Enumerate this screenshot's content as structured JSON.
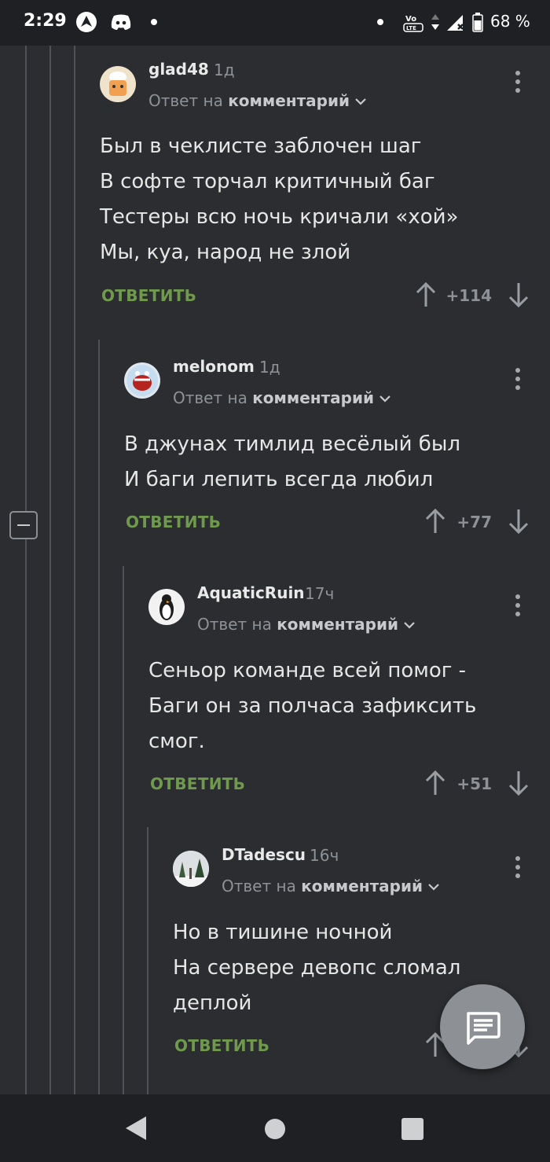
{
  "status_bar": {
    "time": "2:29",
    "battery": "68 %",
    "icons": [
      "arrow-app-icon",
      "discord-icon",
      "notification-dot-icon",
      "dot-icon",
      "volte-icon",
      "data-arrows-icon",
      "signal-icon",
      "battery-icon"
    ]
  },
  "reply_prefix": "Ответ на",
  "reply_target": "комментарий",
  "reply_label": "ОТВЕТИТЬ",
  "colors": {
    "background": "#2b2d30",
    "reply_green": "#6f9a4d",
    "muted": "#8e9196"
  },
  "comments": [
    {
      "author": "glad48",
      "age": "1д",
      "lines": [
        "Был в чеклисте заблочен шаг",
        "В софте торчал критичный баг",
        "Тестеры всю ночь кричали «хой»",
        "Мы, куа, народ не злой"
      ],
      "score": "+114"
    },
    {
      "author": "melonom",
      "age": "1д",
      "lines": [
        "В джунах тимлид весёлый был",
        "И баги лепить всегда любил"
      ],
      "score": "+77"
    },
    {
      "author": "AquaticRuin",
      "age": "17ч",
      "lines": [
        "Сеньор команде всей помог -",
        "Баги он за полчаса зафиксить",
        "смог."
      ],
      "score": "+51"
    },
    {
      "author": "DTadescu",
      "age": "16ч",
      "lines": [
        "Но в тишине ночной",
        "На сервере девопс сломал",
        "деплой"
      ],
      "score": ""
    }
  ],
  "nav": {
    "icons": [
      "back-icon",
      "home-icon",
      "recents-icon"
    ]
  },
  "fab": {
    "icon": "comment-icon"
  }
}
